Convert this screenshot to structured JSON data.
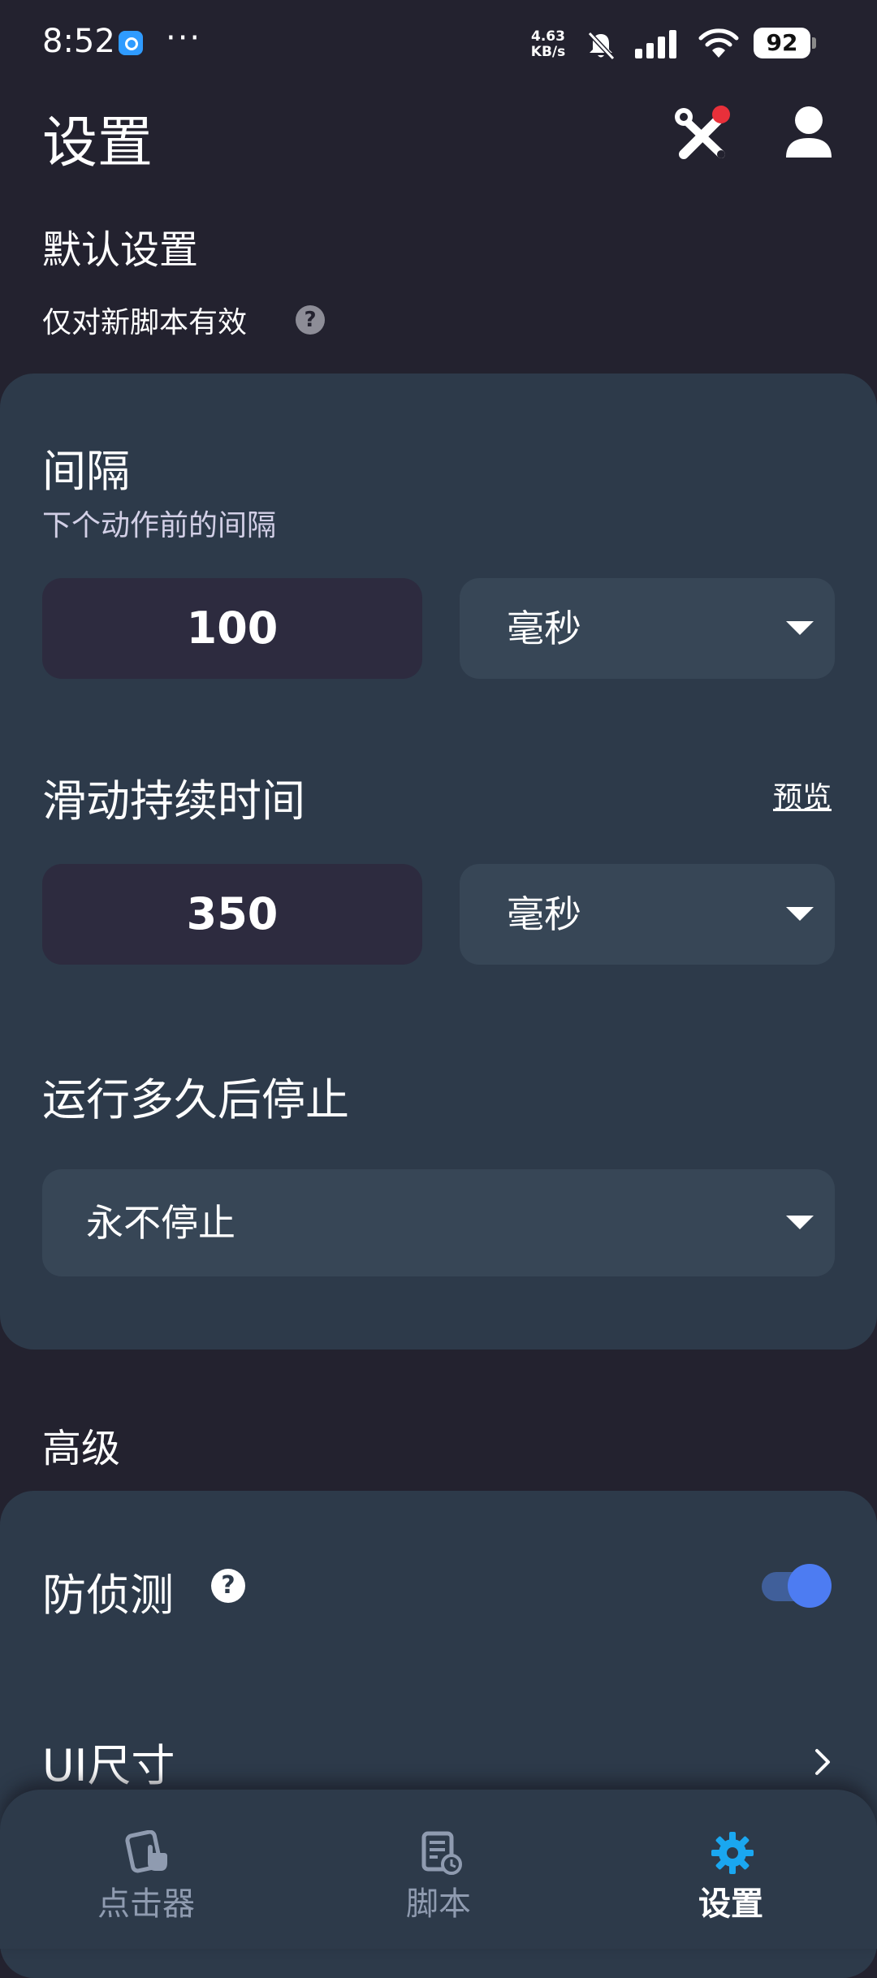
{
  "status_bar": {
    "time": "8:52",
    "dots": "···",
    "net_speed_value": "4.63",
    "net_speed_unit": "KB/s",
    "battery": "92"
  },
  "header": {
    "title": "设置"
  },
  "defaults": {
    "section_title": "默认设置",
    "note": "仅对新脚本有效",
    "interval": {
      "title": "间隔",
      "desc": "下个动作前的间隔",
      "value": "100",
      "unit": "毫秒"
    },
    "swipe_duration": {
      "title": "滑动持续时间",
      "preview_label": "预览",
      "value": "350",
      "unit": "毫秒"
    },
    "stop_after": {
      "title": "运行多久后停止",
      "value": "永不停止"
    }
  },
  "advanced": {
    "section_title": "高级",
    "anti_detect": {
      "label": "防侦测",
      "enabled": true
    },
    "ui_size": {
      "label": "UI尺寸"
    }
  },
  "bottom_nav": {
    "items": [
      {
        "label": "点击器",
        "icon": "clicker-icon",
        "active": false
      },
      {
        "label": "脚本",
        "icon": "script-icon",
        "active": false
      },
      {
        "label": "设置",
        "icon": "gear-icon",
        "active": true
      }
    ]
  },
  "colors": {
    "background": "#23222f",
    "card": "#2d3a4a",
    "input": "#2d2b3f",
    "dropdown": "#374656",
    "accent": "#4d7cf2",
    "active_nav_icon": "#1aa7f0",
    "badge_red": "#e8303a"
  }
}
